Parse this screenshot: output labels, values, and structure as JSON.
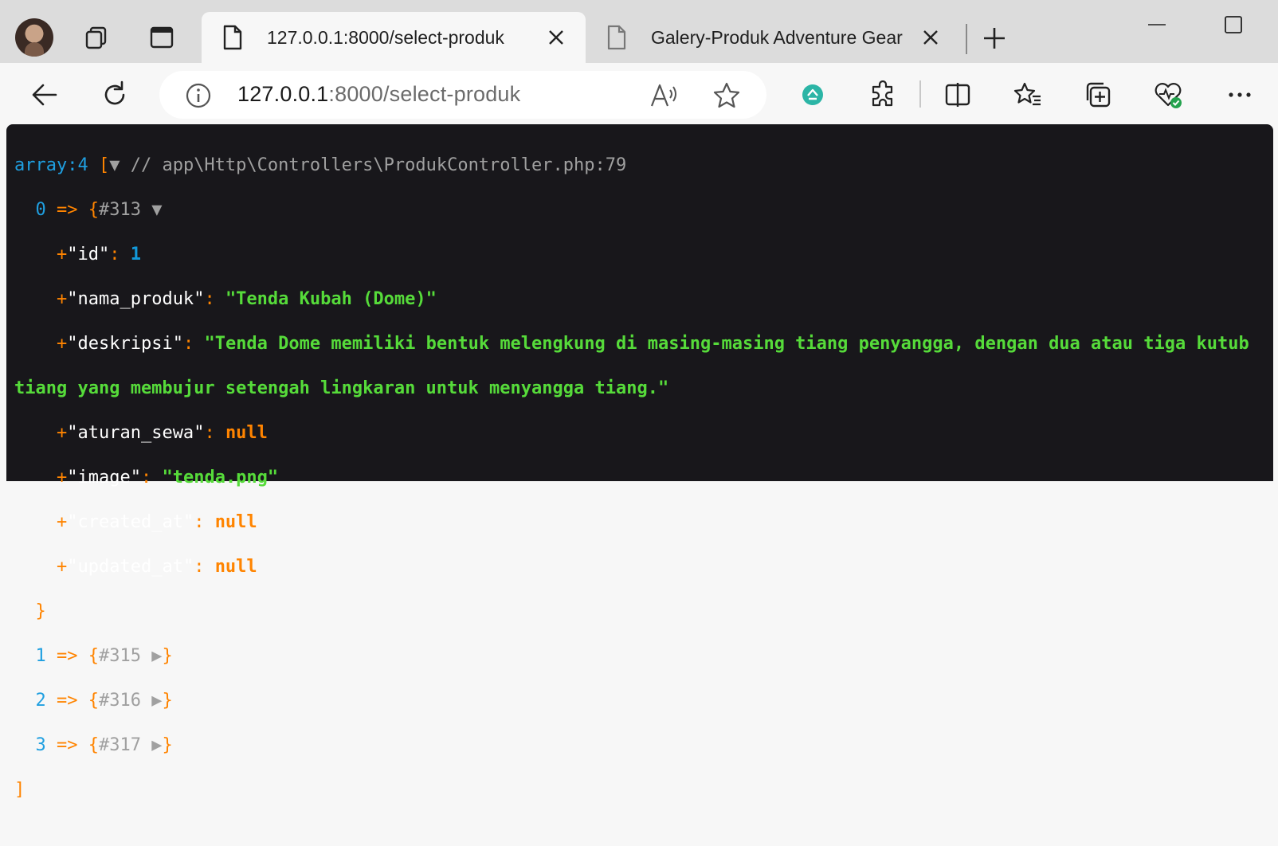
{
  "browser": {
    "tabs": [
      {
        "title": "127.0.0.1:8000/select-produk",
        "active": true
      },
      {
        "title": "Galery-Produk Adventure Gear",
        "active": false
      }
    ],
    "address": {
      "host": "127.0.0.1",
      "rest": ":8000/select-produk"
    },
    "icons": [
      "profile-avatar",
      "workspaces-icon",
      "tab-actions-icon",
      "page-icon",
      "close-icon",
      "new-tab-icon",
      "minimize-icon",
      "maximize-icon",
      "back-icon",
      "refresh-icon",
      "info-icon",
      "read-aloud-icon",
      "favorite-star-icon",
      "extension-brand-icon",
      "extensions-puzzle-icon",
      "split-screen-icon",
      "favorites-icon",
      "collections-icon",
      "browser-essentials-icon",
      "more-icon"
    ]
  },
  "dump": {
    "header_type": "array:4",
    "header_open": "[",
    "header_toggle": "▼",
    "header_comment": "// app\\Http\\Controllers\\ProdukController.php:79",
    "item0": {
      "index": "0",
      "arrow": "=>",
      "ref": "#313",
      "toggle": "▼",
      "fields": {
        "id_key": "id",
        "id_val": "1",
        "nama_key": "nama_produk",
        "nama_val": "\"Tenda Kubah (Dome)\"",
        "desk_key": "deskripsi",
        "desk_line1": "\"Tenda Dome memiliki bentuk melengkung di masing-masing tiang penyangga, dengan dua atau tiga kutub",
        "desk_line2": "tiang yang membujur setengah lingkaran untuk menyangga tiang.\"",
        "aturan_key": "aturan_sewa",
        "aturan_val": "null",
        "image_key": "image",
        "image_val": "\"tenda.png\"",
        "created_key": "created_at",
        "created_val": "null",
        "updated_key": "updated_at",
        "updated_val": "null"
      }
    },
    "collapsed": [
      {
        "index": "1",
        "ref": "#315"
      },
      {
        "index": "2",
        "ref": "#316"
      },
      {
        "index": "3",
        "ref": "#317"
      }
    ],
    "collapsed_toggle": "▶",
    "arrow": "=>",
    "footer_close": "]",
    "colors": {
      "background": "#18171b",
      "key": "#1f9fe0",
      "punct": "#ff8400",
      "string": "#56db3a"
    }
  }
}
